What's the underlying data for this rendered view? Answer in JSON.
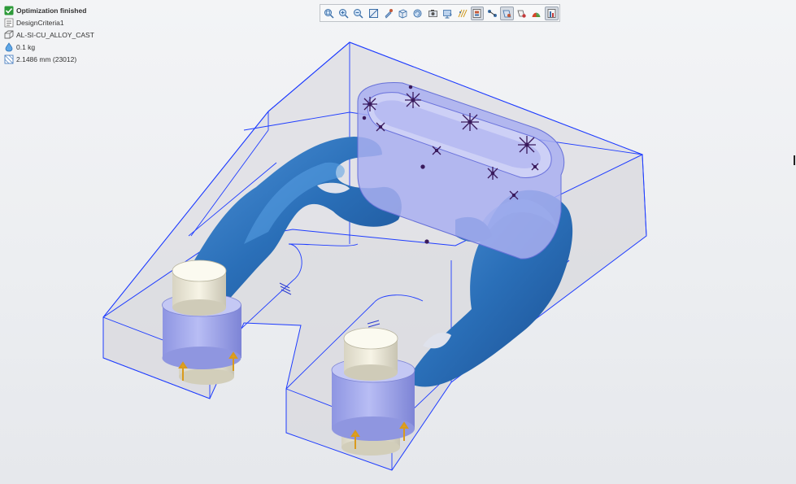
{
  "status_panel": {
    "items": [
      {
        "icon": "check-icon",
        "text": "Optimization finished",
        "bold": true
      },
      {
        "icon": "criteria-icon",
        "text": "DesignCriteria1",
        "bold": false
      },
      {
        "icon": "material-icon",
        "text": "AL-SI-CU_ALLOY_CAST",
        "bold": false
      },
      {
        "icon": "mass-icon",
        "text": "0.1 kg",
        "bold": false
      },
      {
        "icon": "mesh-size-icon",
        "text": "2.1486 mm (23012)",
        "bold": false
      }
    ]
  },
  "toolbar": {
    "buttons": [
      {
        "name": "zoom-fit-icon",
        "active": false
      },
      {
        "name": "zoom-in-icon",
        "active": false
      },
      {
        "name": "zoom-out-icon",
        "active": false
      },
      {
        "name": "zoom-area-icon",
        "active": false
      },
      {
        "name": "pan-icon",
        "active": false
      },
      {
        "name": "view-cube-icon",
        "active": false
      },
      {
        "name": "rotate-view-icon",
        "active": false
      },
      {
        "name": "camera-icon",
        "active": false
      },
      {
        "name": "display-mode-icon",
        "active": false
      },
      {
        "name": "section-icon",
        "active": false
      },
      {
        "name": "show-design-space-icon",
        "active": true
      },
      {
        "name": "connections-icon",
        "active": false
      },
      {
        "name": "show-constraints-icon",
        "active": true
      },
      {
        "name": "show-loads-icon",
        "active": false
      },
      {
        "name": "color-map-icon",
        "active": false
      },
      {
        "name": "results-icon",
        "active": true
      }
    ]
  },
  "colors": {
    "design_space_fill": "#dcdde2",
    "design_space_edge": "#1e3cff",
    "result_body": "#2a6fb8",
    "keep_region": "#aab0ee",
    "cylinder_top": "#fbfaf0",
    "load_marker": "#3a1a5c",
    "constraint_marker": "#e0a020"
  }
}
